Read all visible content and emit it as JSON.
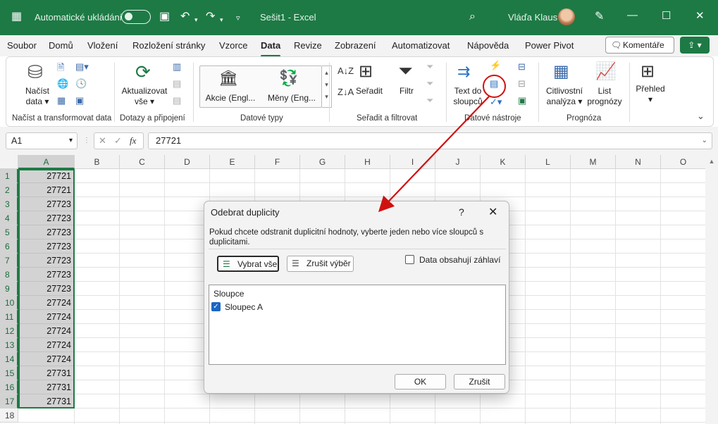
{
  "titlebar": {
    "autosave_label": "Automatické ukládání",
    "doc_title": "Sešit1  -  Excel",
    "user_name": "Vláďa Klaus"
  },
  "menu": {
    "items": [
      "Soubor",
      "Domů",
      "Vložení",
      "Rozložení stránky",
      "Vzorce",
      "Data",
      "Revize",
      "Zobrazení",
      "Automatizovat",
      "Nápověda",
      "Power Pivot"
    ],
    "active": "Data",
    "comments_label": "Komentáře"
  },
  "ribbon": {
    "get_data": {
      "line1": "Načíst",
      "line2": "data ▾"
    },
    "refresh": {
      "line1": "Aktualizovat",
      "line2": "vše ▾"
    },
    "stocks": "Akcie (Engl...",
    "currencies": "Měny (Eng...",
    "sort": "Seřadit",
    "filter": "Filtr",
    "text_to_columns": {
      "line1": "Text do",
      "line2": "sloupců"
    },
    "what_if": {
      "line1": "Citlivostní",
      "line2": "analýza ▾"
    },
    "forecast_sheet": {
      "line1": "List",
      "line2": "prognózy"
    },
    "outline": {
      "line1": "Přehled",
      "line2": "▾"
    },
    "groups": {
      "get_transform": "Načíst a transformovat data",
      "queries": "Dotazy a připojení",
      "data_types": "Datové typy",
      "sort_filter": "Seřadit a filtrovat",
      "data_tools": "Datové nástroje",
      "forecast": "Prognóza"
    }
  },
  "formula_bar": {
    "name_box": "A1",
    "fx": "fx",
    "value": "27721"
  },
  "grid": {
    "columns": [
      "A",
      "B",
      "C",
      "D",
      "E",
      "F",
      "G",
      "H",
      "I",
      "J",
      "K",
      "L",
      "M",
      "N",
      "O"
    ],
    "rows": [
      "1",
      "2",
      "3",
      "4",
      "5",
      "6",
      "7",
      "8",
      "9",
      "10",
      "11",
      "12",
      "13",
      "14",
      "15",
      "16",
      "17",
      "18"
    ],
    "values_a": [
      "27721",
      "27721",
      "27723",
      "27723",
      "27723",
      "27723",
      "27723",
      "27723",
      "27723",
      "27724",
      "27724",
      "27724",
      "27724",
      "27724",
      "27731",
      "27731",
      "27731"
    ]
  },
  "dialog": {
    "title": "Odebrat duplicity",
    "help": "?",
    "close": "✕",
    "description": "Pokud chcete odstranit duplicitní hodnoty, vyberte jeden nebo více sloupců s duplicitami.",
    "select_all": "Vybrat vše",
    "unselect_all": "Zrušit výběr",
    "headers_label": "Data obsahují záhlaví",
    "columns_header": "Sloupce",
    "column_item": "Sloupec A",
    "ok": "OK",
    "cancel": "Zrušit"
  }
}
